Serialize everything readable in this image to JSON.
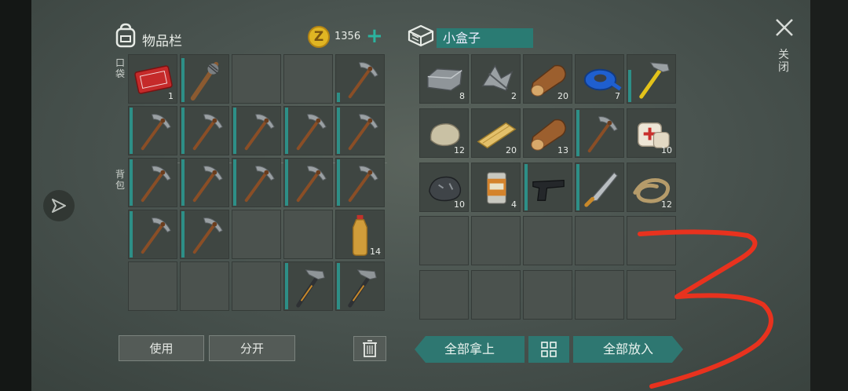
{
  "inventory": {
    "title": "物品栏",
    "coin_count": "1356",
    "pocket_label": "口袋",
    "backpack_label": "背包",
    "slots": [
      {
        "item": "coupon",
        "qty": "1",
        "dur": 0
      },
      {
        "item": "club",
        "qty": "",
        "dur": 0.95
      },
      {
        "item": "",
        "qty": "",
        "dur": 0
      },
      {
        "item": "",
        "qty": "",
        "dur": 0
      },
      {
        "item": "pickaxe",
        "qty": "",
        "dur": 0.2
      },
      {
        "item": "pickaxe",
        "qty": "",
        "dur": 1
      },
      {
        "item": "pickaxe",
        "qty": "",
        "dur": 1
      },
      {
        "item": "pickaxe",
        "qty": "",
        "dur": 1
      },
      {
        "item": "pickaxe",
        "qty": "",
        "dur": 1
      },
      {
        "item": "pickaxe",
        "qty": "",
        "dur": 1
      },
      {
        "item": "pickaxe",
        "qty": "",
        "dur": 1
      },
      {
        "item": "pickaxe",
        "qty": "",
        "dur": 1
      },
      {
        "item": "pickaxe",
        "qty": "",
        "dur": 1
      },
      {
        "item": "pickaxe",
        "qty": "",
        "dur": 1
      },
      {
        "item": "pickaxe",
        "qty": "",
        "dur": 1
      },
      {
        "item": "pickaxe",
        "qty": "",
        "dur": 1
      },
      {
        "item": "pickaxe",
        "qty": "",
        "dur": 1
      },
      {
        "item": "",
        "qty": "",
        "dur": 0
      },
      {
        "item": "",
        "qty": "",
        "dur": 0
      },
      {
        "item": "bottle",
        "qty": "14",
        "dur": 0
      },
      {
        "item": "",
        "qty": "",
        "dur": 0
      },
      {
        "item": "",
        "qty": "",
        "dur": 0
      },
      {
        "item": "",
        "qty": "",
        "dur": 0
      },
      {
        "item": "hammer",
        "qty": "",
        "dur": 1
      },
      {
        "item": "hammer",
        "qty": "",
        "dur": 1
      }
    ]
  },
  "box": {
    "title": "小盒子",
    "slots": [
      {
        "item": "metal-ingot",
        "qty": "8",
        "dur": 0
      },
      {
        "item": "scrap",
        "qty": "2",
        "dur": 0
      },
      {
        "item": "log",
        "qty": "20",
        "dur": 0
      },
      {
        "item": "tape",
        "qty": "7",
        "dur": 0
      },
      {
        "item": "hammer-yellow",
        "qty": "",
        "dur": 0.7
      },
      {
        "item": "stone",
        "qty": "12",
        "dur": 0
      },
      {
        "item": "plank",
        "qty": "20",
        "dur": 0
      },
      {
        "item": "log",
        "qty": "13",
        "dur": 0
      },
      {
        "item": "pickaxe",
        "qty": "",
        "dur": 1
      },
      {
        "item": "bandage",
        "qty": "10",
        "dur": 0
      },
      {
        "item": "ore",
        "qty": "10",
        "dur": 0
      },
      {
        "item": "can",
        "qty": "4",
        "dur": 0
      },
      {
        "item": "pistol",
        "qty": "",
        "dur": 1
      },
      {
        "item": "machete",
        "qty": "",
        "dur": 1
      },
      {
        "item": "rope",
        "qty": "12",
        "dur": 0
      },
      {
        "item": "",
        "qty": "",
        "dur": 0
      },
      {
        "item": "",
        "qty": "",
        "dur": 0
      },
      {
        "item": "",
        "qty": "",
        "dur": 0
      },
      {
        "item": "",
        "qty": "",
        "dur": 0
      },
      {
        "item": "",
        "qty": "",
        "dur": 0
      },
      {
        "item": "",
        "qty": "",
        "dur": 0
      },
      {
        "item": "",
        "qty": "",
        "dur": 0
      },
      {
        "item": "",
        "qty": "",
        "dur": 0
      },
      {
        "item": "",
        "qty": "",
        "dur": 0
      },
      {
        "item": "",
        "qty": "",
        "dur": 0
      }
    ]
  },
  "buttons": {
    "use": "使用",
    "split": "分开",
    "take_all": "全部拿上",
    "put_all": "全部放入",
    "close": "关闭"
  },
  "icons": {
    "backpack": "backpack-icon",
    "coin": "coin-icon",
    "box": "box-icon",
    "trash": "trash-icon",
    "close": "close-icon",
    "nav": "navigation-arrow-icon"
  },
  "coin_symbol": "Z",
  "annotation_color": "#e8321e",
  "accent_color": "#2e7771"
}
